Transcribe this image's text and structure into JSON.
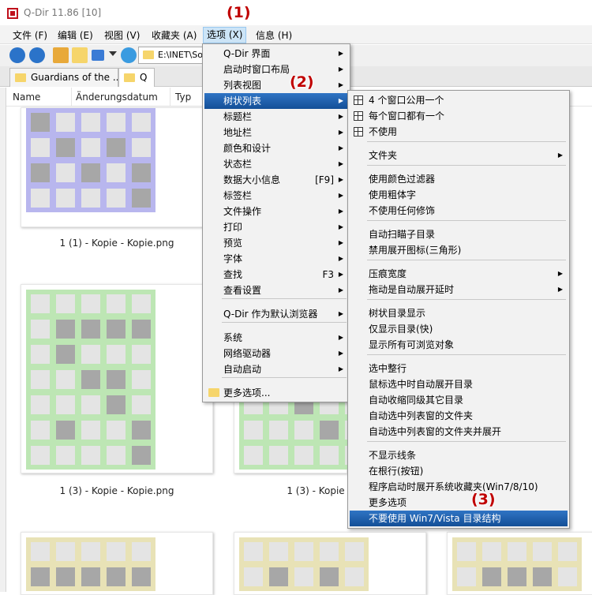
{
  "window": {
    "title": "Q-Dir 11.86 [10]"
  },
  "menubar": [
    "文件 (F)",
    "编辑 (E)",
    "视图 (V)",
    "收藏夹 (A)",
    "选项 (X)",
    "信息 (H)"
  ],
  "toolbar": {
    "address": "E:\\INET\\So"
  },
  "tabs": [
    "Guardians of the ...",
    "Q"
  ],
  "columns": [
    "Name",
    "Änderungsdatum",
    "Typ"
  ],
  "captions": [
    "1 (1) - Kopie - Kopie.png",
    "1 (3) - Kopie - Kopie.png",
    "1 (3) - Kopie"
  ],
  "options_menu": [
    {
      "label": "Q-Dir 界面",
      "arrow": true
    },
    {
      "label": "启动时窗口布局",
      "arrow": true
    },
    {
      "label": "列表视图",
      "arrow": true
    },
    {
      "label": "树状列表",
      "arrow": true
    },
    {
      "label": "标题栏",
      "arrow": true
    },
    {
      "label": "地址栏",
      "arrow": true
    },
    {
      "label": "颜色和设计",
      "arrow": true
    },
    {
      "label": "状态栏",
      "arrow": true
    },
    {
      "label": "数据大小信息",
      "shortcut": "[F9]",
      "arrow": true
    },
    {
      "label": "标签栏",
      "arrow": true
    },
    {
      "label": "文件操作",
      "arrow": true
    },
    {
      "label": "打印",
      "arrow": true
    },
    {
      "label": "预览",
      "arrow": true
    },
    {
      "label": "字体",
      "arrow": true
    },
    {
      "label": "查找",
      "shortcut": "F3",
      "arrow": true
    },
    {
      "label": "查看设置",
      "arrow": true
    },
    {
      "label": "Q-Dir 作为默认浏览器",
      "arrow": true
    },
    {
      "label": "系统",
      "arrow": true
    },
    {
      "label": "网络驱动器",
      "arrow": true
    },
    {
      "label": "自动启动",
      "arrow": true
    },
    {
      "label": "更多选项...",
      "arrow": false
    }
  ],
  "tree_submenu": [
    {
      "label": "4 个窗口公用一个",
      "icon": "grid-4-icon"
    },
    {
      "label": "每个窗口都有一个",
      "icon": "grid-each-icon"
    },
    {
      "label": "不使用",
      "icon": "grid-none-icon"
    },
    {
      "label": "文件夹",
      "arrow": true
    },
    {
      "label": "使用颜色过滤器"
    },
    {
      "label": "使用粗体字"
    },
    {
      "label": "不使用任何修饰"
    },
    {
      "label": "自动扫瞄子目录"
    },
    {
      "label": "禁用展开图标(三角形)"
    },
    {
      "label": "压痕宽度",
      "arrow": true
    },
    {
      "label": "拖动是自动展开延时",
      "arrow": true
    },
    {
      "label": "树状目录显示"
    },
    {
      "label": "仅显示目录(快)"
    },
    {
      "label": "显示所有可浏览对象"
    },
    {
      "label": "选中整行"
    },
    {
      "label": "鼠标选中时自动展开目录"
    },
    {
      "label": "自动收缩同级其它目录"
    },
    {
      "label": "自动选中列表窗的文件夹"
    },
    {
      "label": "自动选中列表窗的文件夹并展开"
    },
    {
      "label": "不显示线条"
    },
    {
      "label": "在根行(按钮)"
    },
    {
      "label": "程序启动时展开系统收藏夹(Win7/8/10)"
    },
    {
      "label": "更多选项"
    },
    {
      "label": "不要使用 Win7/Vista 目录结构"
    }
  ],
  "steps": [
    "(1)",
    "(2)",
    "(3)"
  ],
  "colors": {
    "highlight": "#1f5fa7",
    "step": "#c00000",
    "thumb_purple": "#b8b6ee",
    "thumb_green": "#bde6b4",
    "thumb_yellow": "#e8e2b6"
  }
}
